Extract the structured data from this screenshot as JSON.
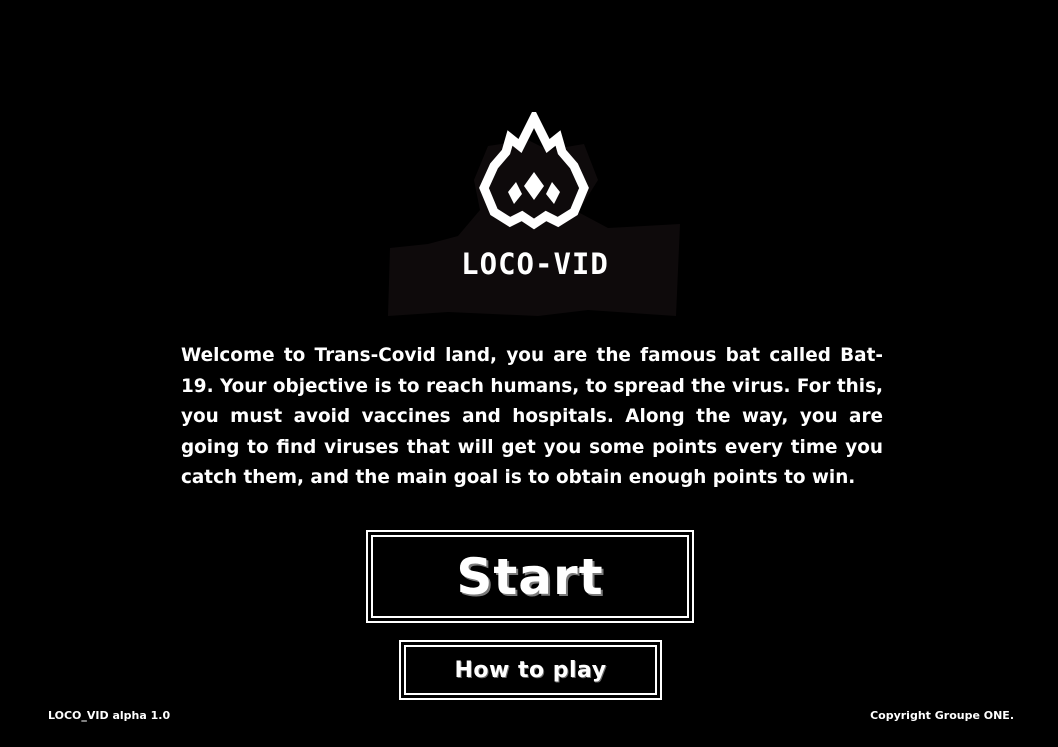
{
  "app": {
    "logo_title": "LOCO-VID",
    "logo_icon": "flame-bat-icon"
  },
  "intro": {
    "text": "Welcome to Trans-Covid land, you are the famous bat called Bat-19. Your objective is to reach humans, to spread the virus.  For this, you must avoid vaccines and hospitals. Along the way, you are going to find viruses that will get you some points every time you catch them, and the main goal is to obtain enough points to win."
  },
  "menu": {
    "start_label": "Start",
    "how_to_play_label": "How to play"
  },
  "footer": {
    "version": "LOCO_VID alpha 1.0",
    "copyright": "Copyright  Groupe ONE."
  },
  "colors": {
    "background": "#000000",
    "text": "#ffffff",
    "logo_backdrop": "#0e0a0b"
  }
}
